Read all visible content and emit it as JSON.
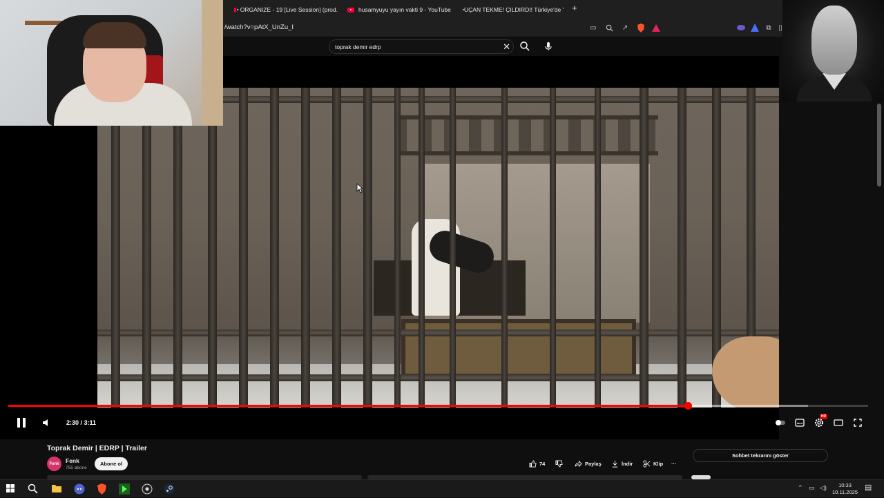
{
  "browser": {
    "tabs": [
      {
        "label": "ORGANIZE - 19 [Live Session] (prod."
      },
      {
        "label": "husamyuyu yayın vakti 9 - YouTube"
      },
      {
        "label": "UÇAN TEKME! ÇILDIRDI! Türkiye'de Y"
      }
    ],
    "new_tab_label": "+",
    "url": "/watch?v=pAtX_UnZu_I"
  },
  "search": {
    "query": "toprak demir edrp",
    "clear_label": "✕"
  },
  "player": {
    "time": "2:30 / 3:11",
    "progress": 0.79,
    "buffered": 0.93,
    "hd_badge": "HD"
  },
  "video_info": {
    "title": "Toprak Demir | EDRP | Trailer",
    "channel_name": "Fenk",
    "channel_avatar_text": "Fenk",
    "subscribers": "755 abone",
    "subscribe_label": "Abone ol",
    "like_count": "74",
    "share_label": "Paylaş",
    "download_label": "İndir",
    "clip_label": "Klip",
    "more_label": "···"
  },
  "chat": {
    "replay_label": "Sohbet tekrarını göster"
  },
  "taskbar": {
    "time": "10:33",
    "date": "10.11.2025"
  },
  "colors": {
    "accent": "#ff0000",
    "background": "#0f0f0f"
  }
}
